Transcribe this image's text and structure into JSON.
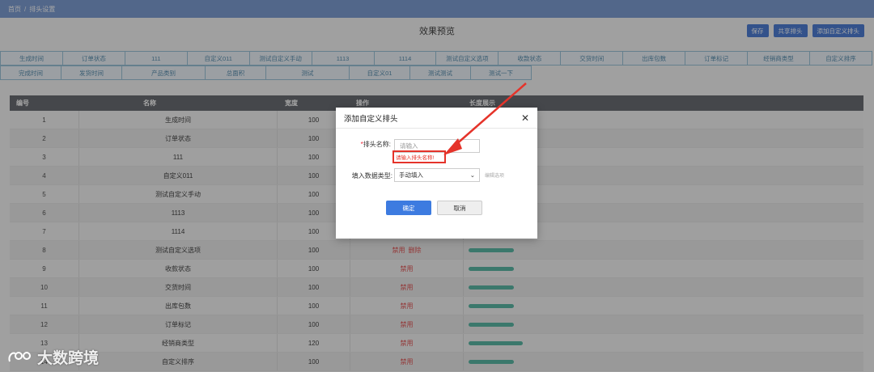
{
  "breadcrumb": {
    "home": "首页",
    "separator": "/",
    "current": "排头设置"
  },
  "preview_title": "效果预览",
  "buttons": {
    "save": "保存",
    "share": "共享排头",
    "add_custom": "添加自定义排头"
  },
  "chips_row1": [
    "生成时间",
    "订单状态",
    "111",
    "自定义011",
    "测试自定义手动",
    "1113",
    "1114",
    "测试自定义选项",
    "收款状态",
    "交货时间",
    "出库包数",
    "订单标记",
    "经销商类型",
    "自定义排序"
  ],
  "chips_row2": [
    "完成时间",
    "发货时间",
    "产品类别",
    "总面积",
    "测试",
    "自定义01",
    "测试测试",
    "测试一下"
  ],
  "table": {
    "headers": {
      "no": "编号",
      "name": "名称",
      "width": "宽度",
      "action": "操作",
      "length": "长度展示"
    },
    "rows": [
      {
        "no": "1",
        "name": "生成时间",
        "width": "100"
      },
      {
        "no": "2",
        "name": "订单状态",
        "width": "100"
      },
      {
        "no": "3",
        "name": "111",
        "width": "100"
      },
      {
        "no": "4",
        "name": "自定义011",
        "width": "100"
      },
      {
        "no": "5",
        "name": "测试自定义手动",
        "width": "100"
      },
      {
        "no": "6",
        "name": "1113",
        "width": "100"
      },
      {
        "no": "7",
        "name": "1114",
        "width": "100"
      },
      {
        "no": "8",
        "name": "测试自定义选项",
        "width": "100",
        "disable": "禁用",
        "delete": "删除"
      },
      {
        "no": "9",
        "name": "收款状态",
        "width": "100",
        "disable": "禁用"
      },
      {
        "no": "10",
        "name": "交货时间",
        "width": "100",
        "disable": "禁用"
      },
      {
        "no": "11",
        "name": "出库包数",
        "width": "100",
        "disable": "禁用"
      },
      {
        "no": "12",
        "name": "订单标记",
        "width": "100",
        "disable": "禁用"
      },
      {
        "no": "13",
        "name": "经销商类型",
        "width": "120",
        "disable": "禁用"
      },
      {
        "no": "14",
        "name": "自定义排序",
        "width": "100",
        "disable": "禁用"
      }
    ]
  },
  "dialog": {
    "title": "添加自定义排头",
    "required_mark": "*",
    "name_label": "排头名称:",
    "name_placeholder": "请输入",
    "name_error": "请输入排头名称!",
    "type_label": "填入数据类型:",
    "type_value": "手动填入",
    "edit_options": "编辑选项",
    "ok": "确定",
    "cancel": "取消"
  },
  "watermark": "大数跨境",
  "colors": {
    "topbar": "#7f9fd4",
    "primary": "#3d7be0",
    "error": "#e5332a",
    "bar": "#5bb8a6"
  }
}
